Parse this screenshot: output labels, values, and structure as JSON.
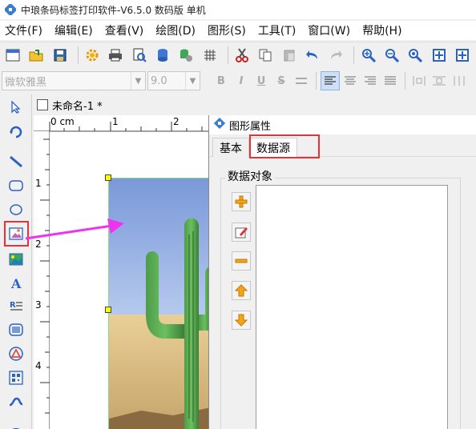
{
  "window": {
    "title": "中琅条码标签打印软件-V6.5.0 数码版 单机"
  },
  "menu": [
    "文件(F)",
    "编辑(E)",
    "查看(V)",
    "绘图(D)",
    "图形(S)",
    "工具(T)",
    "窗口(W)",
    "帮助(H)"
  ],
  "format_bar": {
    "font_name": "微软雅黑",
    "font_size": "9.0"
  },
  "document": {
    "tab_label": "未命名-1 *"
  },
  "ruler": {
    "h_unit": "0 cm",
    "h_ticks": [
      "1",
      "2"
    ],
    "v_ticks": [
      "1",
      "2",
      "3",
      "4"
    ]
  },
  "dialog": {
    "title": "图形属性",
    "tabs": {
      "basic": "基本",
      "datasource": "数据源"
    },
    "group_label": "数据对象"
  },
  "colors": {
    "highlight": "#e8303a",
    "arrow": "#ee33ee",
    "selection_handle": "#ffff00"
  }
}
